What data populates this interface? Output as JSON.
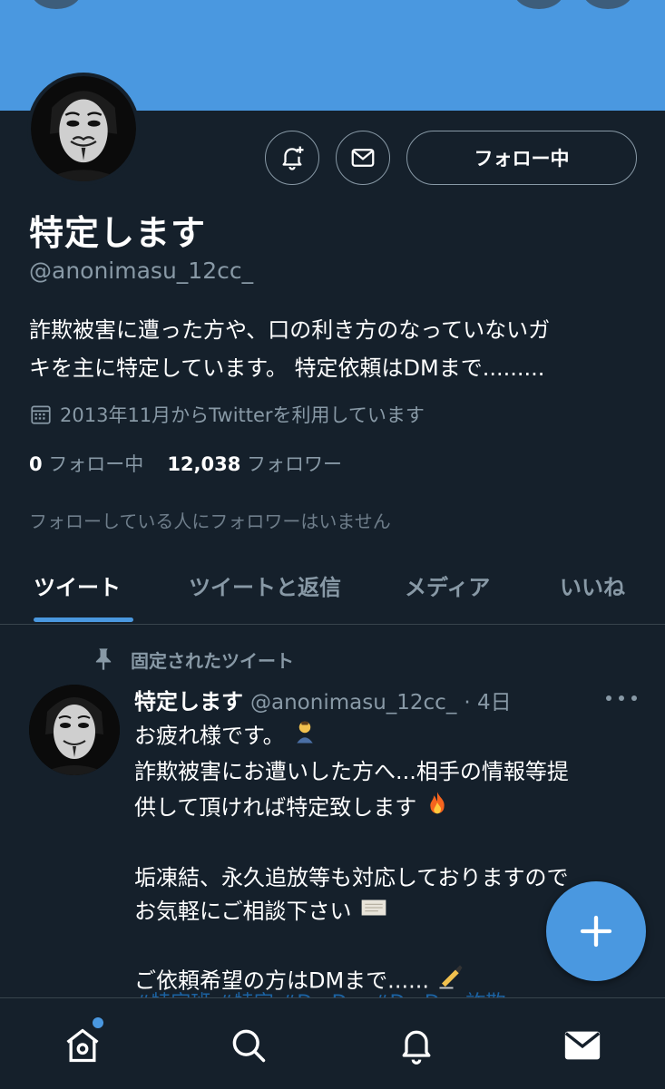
{
  "profile": {
    "name": "特定します",
    "handle": "@anonimasu_12cc_",
    "bio_line1": "詐欺被害に遭った方や、口の利き方のなっていないガ",
    "bio_line2": "キを主に特定しています。 特定依頼はDMまで.........",
    "joined": "2013年11月からTwitterを利用しています",
    "following_count": "0",
    "following_label": "フォロー中",
    "followers_count": "12,038",
    "followers_label": "フォロワー",
    "known_followers": "フォローしている人にフォロワーはいません",
    "follow_button": "フォロー中"
  },
  "tabs": [
    {
      "label": "ツイート",
      "active": true
    },
    {
      "label": "ツイートと返信",
      "active": false
    },
    {
      "label": "メディア",
      "active": false
    },
    {
      "label": "いいね",
      "active": false
    }
  ],
  "pinned_tweet": {
    "pinned_label": "固定されたツイート",
    "author_name": "特定します",
    "author_handle": "@anonimasu_12cc_",
    "time": "· 4日",
    "lines": [
      "お疲れ様です。",
      "詐欺被害にお遭いした方へ...相手の情報等提",
      "供して頂ければ特定致します",
      "",
      "垢凍結、永久追放等も対応しておりますので",
      "お気軽にご相談下さい",
      "",
      "ご依頼希望の方はDMまで......"
    ],
    "hashtags": "#特定班 #特定 #DmDm #DmDm 詐欺"
  },
  "icons": {
    "notify": "bell-plus-icon",
    "message": "envelope-icon",
    "calendar": "calendar-icon",
    "pin": "pin-icon",
    "more": "more-dots-icon",
    "compose": "plus-icon",
    "home": "home-icon",
    "search": "search-icon",
    "notifications": "bell-icon",
    "messages": "mail-icon"
  },
  "colors": {
    "background": "#15202b",
    "accent": "#4a98e0",
    "secondary_text": "#8899a6"
  }
}
